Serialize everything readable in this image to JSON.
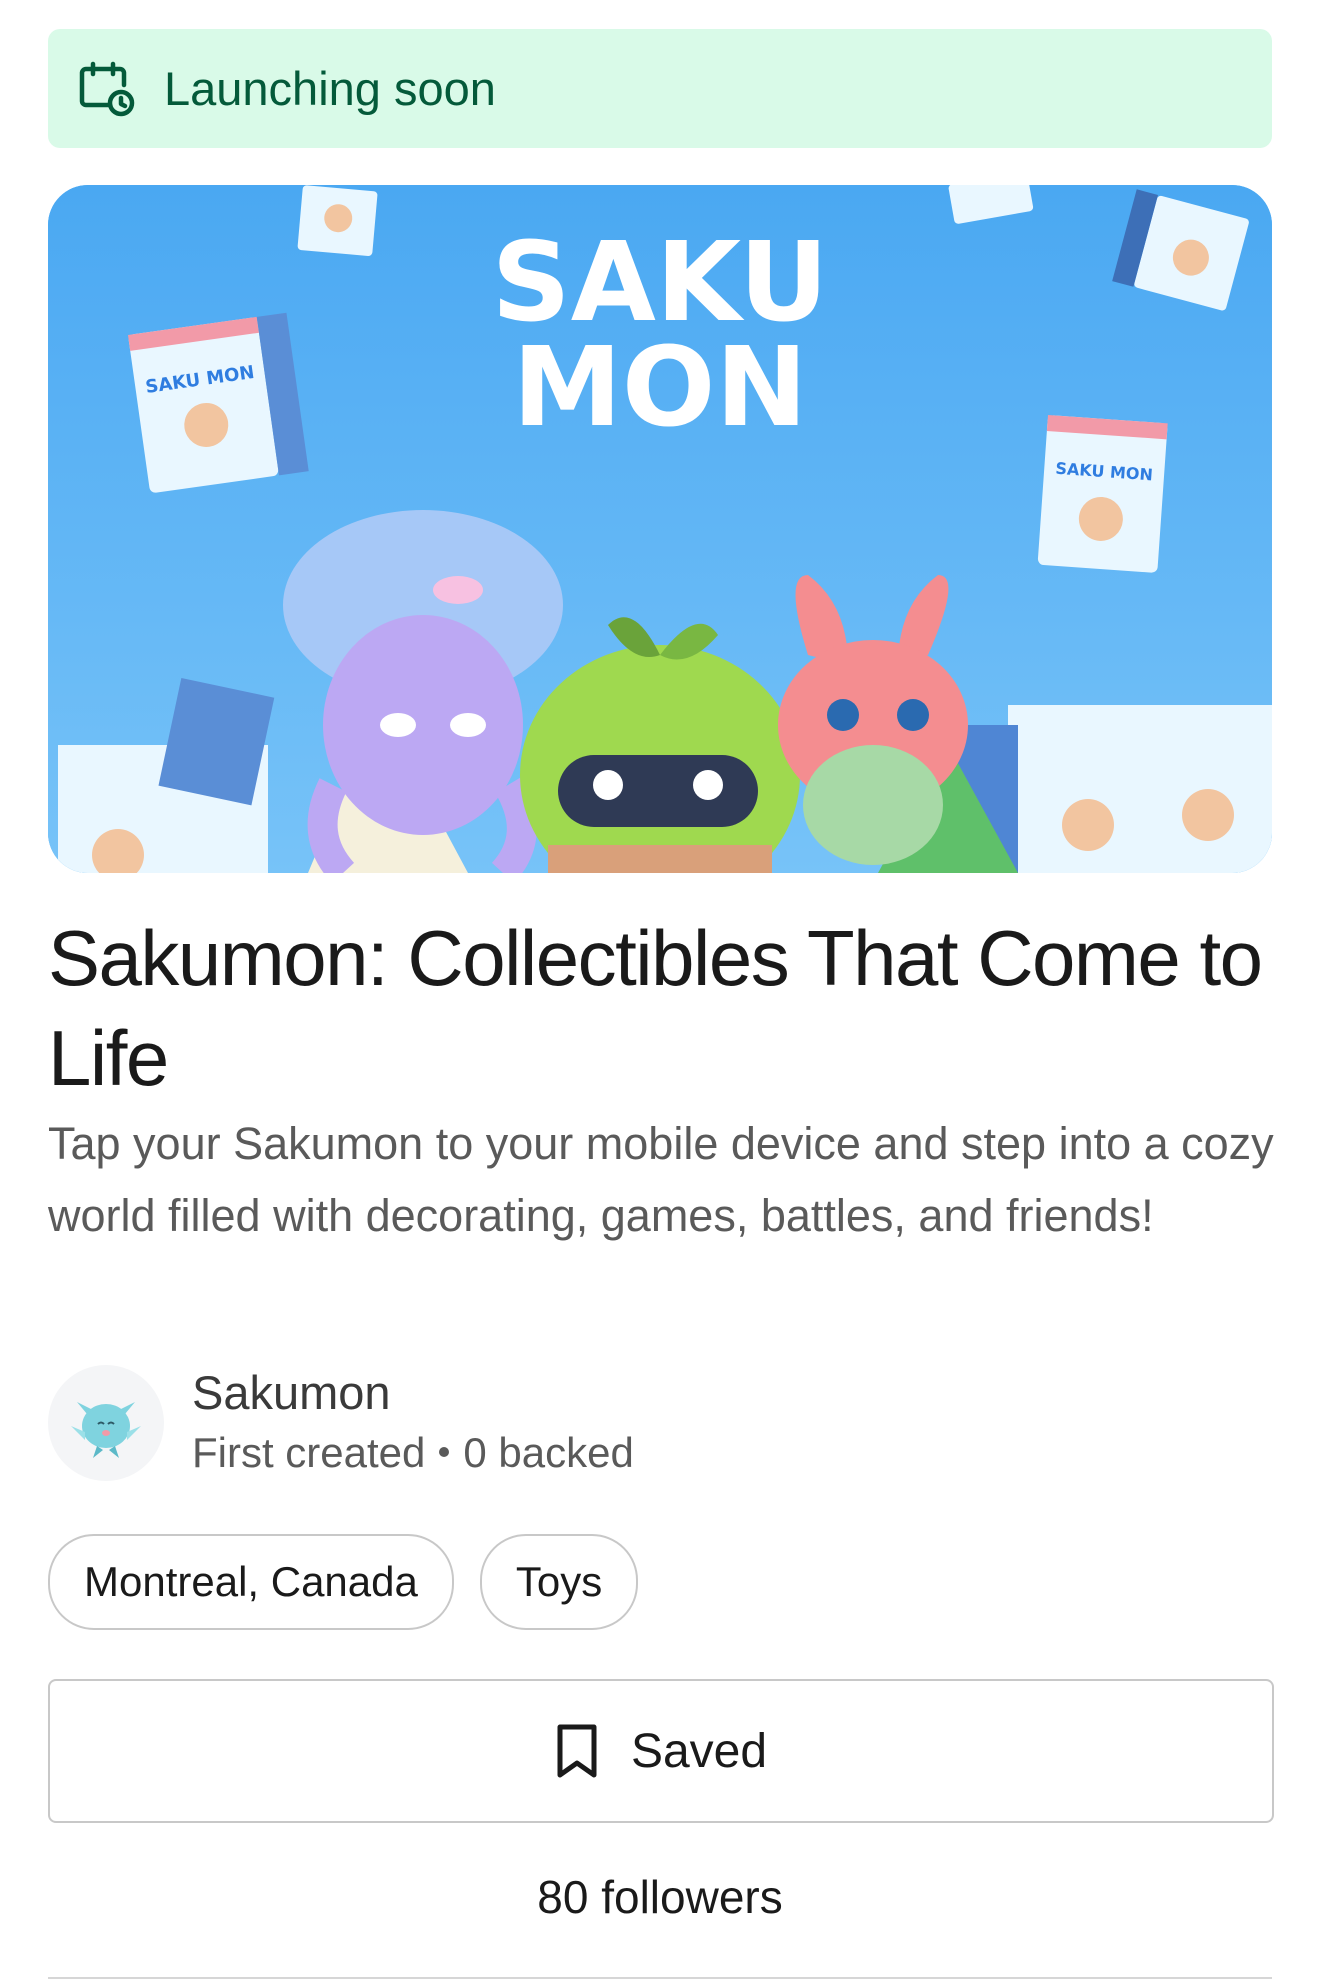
{
  "banner": {
    "label": "Launching soon",
    "icon": "calendar-clock-icon"
  },
  "hero": {
    "logo_line1": "SAKU",
    "logo_line2": "MON",
    "box_label": "SAKU MON"
  },
  "project": {
    "title": "Sakumon: Collectibles That Come to Life",
    "description": "Tap your Sakumon to your mobile device and step into a cozy world filled with decorating, games, battles, and friends!"
  },
  "creator": {
    "name": "Sakumon",
    "first_created": "First created",
    "backed": "0 backed",
    "avatar_icon": "creature-avatar-icon"
  },
  "tags": [
    "Montreal, Canada",
    "Toys"
  ],
  "save_button": {
    "label": "Saved",
    "icon": "bookmark-icon"
  },
  "followers": "80 followers",
  "colors": {
    "banner_bg": "#d9fae8",
    "banner_text": "#045a3a",
    "hero_bg": "#5ab4f6"
  }
}
